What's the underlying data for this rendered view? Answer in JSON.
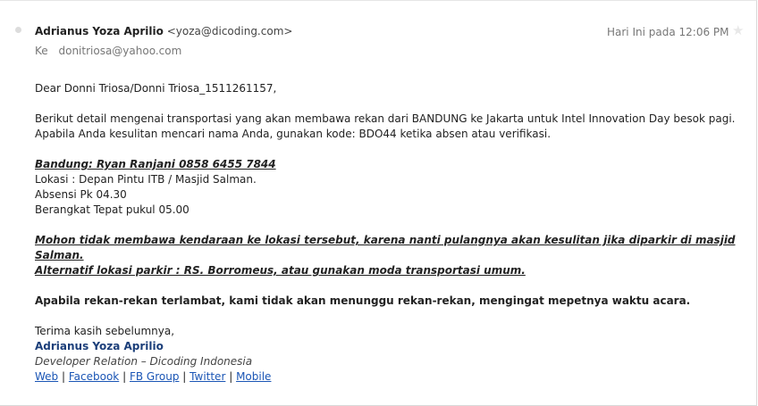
{
  "header": {
    "sender_name": "Adrianus Yoza Aprilio",
    "sender_email": "<yoza@dicoding.com>",
    "time": "Hari Ini pada 12:06 PM",
    "to_label": "Ke",
    "to_address": "donitriosa@yahoo.com"
  },
  "message": {
    "greeting": "Dear Donni Triosa/Donni Triosa_1511261157,",
    "intro_line1": "Berikut detail mengenai transportasi yang akan membawa rekan dari BANDUNG ke Jakarta untuk Intel Innovation Day besok pagi.",
    "intro_line2": "Apabila Anda kesulitan mencari nama Anda, gunakan kode: BDO44 ketika absen atau verifikasi.",
    "contact_heading": "Bandung: Ryan Ranjani 0858 6455 7844",
    "location": "Lokasi : Depan Pintu ITB / Masjid Salman.",
    "attendance": "Absensi Pk 04.30",
    "departure": "Berangkat Tepat pukul 05.00",
    "warning_line1": "Mohon tidak membawa kendaraan ke lokasi tersebut, karena nanti pulangnya akan kesulitan jika diparkir di masjid Salman.",
    "warning_line2": "Alternatif lokasi parkir : RS. Borromeus, atau gunakan moda transportasi umum.",
    "late_notice": "Apabila rekan-rekan terlambat, kami tidak akan menunggu rekan-rekan, mengingat mepetnya waktu acara.",
    "closing": "Terima kasih sebelumnya,"
  },
  "signature": {
    "name": "Adrianus Yoza Aprilio",
    "role": "Developer Relation – Dicoding Indonesia",
    "separator": "|",
    "links": [
      {
        "label": "Web"
      },
      {
        "label": "Facebook"
      },
      {
        "label": "FB Group"
      },
      {
        "label": "Twitter"
      },
      {
        "label": "Mobile"
      }
    ]
  },
  "icons": {
    "unread_dot": "dot-icon",
    "flag": "star-icon"
  },
  "colors": {
    "link": "#1a55b5",
    "signature_name": "#1c3f7a",
    "muted": "#777777"
  }
}
